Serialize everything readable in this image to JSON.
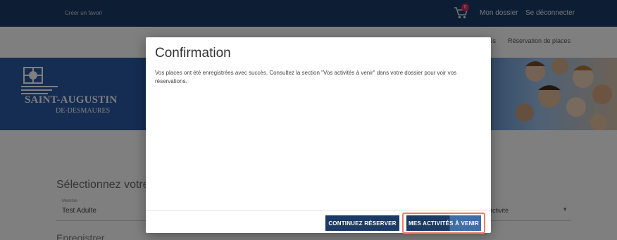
{
  "topbar": {
    "create_link": "Créer un favori",
    "cart_badge": "0",
    "nav_dossier": "Mon dossier",
    "nav_logout": "Se déconnecter"
  },
  "subnav": {
    "item_ities": "ités",
    "item_reserve": "Réservation de places"
  },
  "banner": {
    "logo_name": "SAINT-AUGUSTIN",
    "logo_sub": "DE-DESMAURES"
  },
  "page": {
    "select_heading": "Sélectionnez votre m",
    "member_label": "Membre",
    "member_value": "Test Adulte",
    "activity_value": "activité",
    "save_heading": "Enregistrer"
  },
  "modal": {
    "title": "Confirmation",
    "body": "Vos places ont été enregistrées avec succès. Consultez la section \"Vos activités à venir\" dans votre dossier pour voir vos réservations.",
    "continue_button": "CONTINUEZ RÉSERVER",
    "activities_button": "MES ACTIVITÉS À VENIR"
  },
  "colors": {
    "primary": "#1b3a66",
    "banner": "#2a5aa6",
    "highlight": "#ef7b6a",
    "badge": "#e0245e"
  }
}
